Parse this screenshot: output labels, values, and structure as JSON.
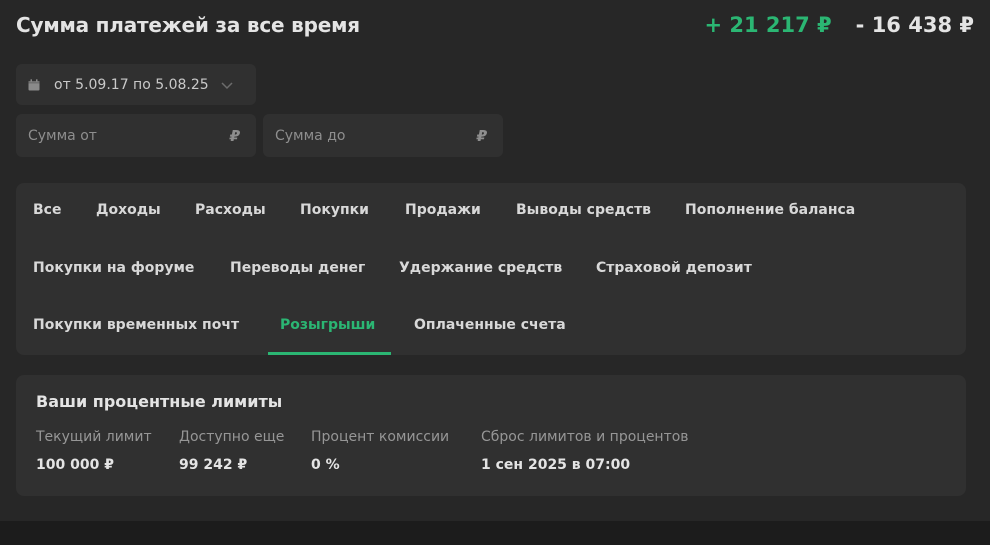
{
  "header": {
    "title": "Сумма платежей за все время",
    "income_total": "+ 21 217 ₽",
    "expense_total": "- 16 438 ₽"
  },
  "filters_form": {
    "date_range": "от 5.09.17 по 5.08.25",
    "amount_from_placeholder": "Сумма от",
    "amount_to_placeholder": "Сумма до",
    "currency_symbol": "₽"
  },
  "tabs": [
    {
      "label": "Все"
    },
    {
      "label": "Доходы"
    },
    {
      "label": "Расходы"
    },
    {
      "label": "Покупки"
    },
    {
      "label": "Продажи"
    },
    {
      "label": "Выводы средств"
    },
    {
      "label": "Пополнение баланса"
    },
    {
      "label": "Покупки на форуме"
    },
    {
      "label": "Переводы денег"
    },
    {
      "label": "Удержание средств"
    },
    {
      "label": "Страховой депозит"
    },
    {
      "label": "Покупки временных почт"
    },
    {
      "label": "Розыгрыши"
    },
    {
      "label": "Оплаченные счета"
    }
  ],
  "active_tab": "Розыгрыши",
  "limits": {
    "title": "Ваши процентные лимиты",
    "columns": [
      {
        "label": "Текущий лимит",
        "value": "100 000 ₽"
      },
      {
        "label": "Доступно еще",
        "value": "99 242 ₽"
      },
      {
        "label": "Процент комиссии",
        "value": "0 %"
      },
      {
        "label": "Сброс лимитов и процентов",
        "value": "1 сен 2025 в 07:00"
      }
    ]
  },
  "colors": {
    "accent": "#2bb673",
    "background": "#272727",
    "panel": "#303030"
  },
  "icons": {
    "date": "calendar-icon",
    "dropdown": "chevron-down-icon"
  }
}
